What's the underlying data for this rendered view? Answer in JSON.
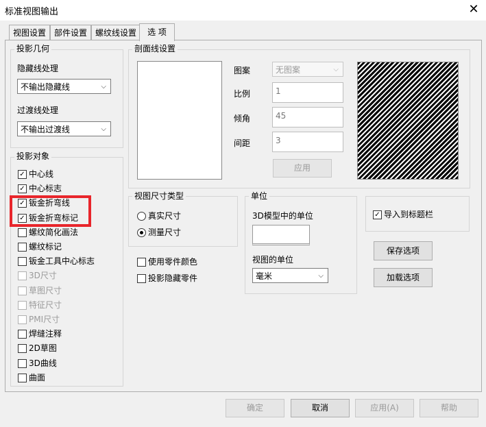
{
  "window": {
    "title": "标准视图输出"
  },
  "tabs": [
    "视图设置",
    "部件设置",
    "螺纹线设置",
    "选 项"
  ],
  "projection_geometry": {
    "title": "投影几何",
    "hidden_line_label": "隐藏线处理",
    "hidden_line_value": "不输出隐藏线",
    "transition_line_label": "过渡线处理",
    "transition_line_value": "不输出过渡线"
  },
  "projection_objects": {
    "title": "投影对象",
    "items": [
      {
        "label": "中心线",
        "checked": true,
        "enabled": true
      },
      {
        "label": "中心标志",
        "checked": true,
        "enabled": true
      },
      {
        "label": "钣金折弯线",
        "checked": true,
        "enabled": true
      },
      {
        "label": "钣金折弯标记",
        "checked": true,
        "enabled": true
      },
      {
        "label": "螺纹简化画法",
        "checked": false,
        "enabled": true
      },
      {
        "label": "螺纹标记",
        "checked": false,
        "enabled": true
      },
      {
        "label": "钣金工具中心标志",
        "checked": false,
        "enabled": true
      },
      {
        "label": "3D尺寸",
        "checked": false,
        "enabled": false
      },
      {
        "label": "草图尺寸",
        "checked": false,
        "enabled": false
      },
      {
        "label": "特征尺寸",
        "checked": false,
        "enabled": false
      },
      {
        "label": "PMI尺寸",
        "checked": false,
        "enabled": false
      },
      {
        "label": "焊缝注释",
        "checked": false,
        "enabled": true
      },
      {
        "label": "2D草图",
        "checked": false,
        "enabled": true
      },
      {
        "label": "3D曲线",
        "checked": false,
        "enabled": true
      },
      {
        "label": "曲面",
        "checked": false,
        "enabled": true
      }
    ]
  },
  "section_line": {
    "title": "剖面线设置",
    "pattern_label": "图案",
    "pattern_value": "无图案",
    "scale_label": "比例",
    "scale_value": "1",
    "angle_label": "倾角",
    "angle_value": "45",
    "spacing_label": "间距",
    "spacing_value": "3",
    "apply_label": "应用"
  },
  "dimension_type": {
    "title": "视图尺寸类型",
    "options": [
      {
        "label": "真实尺寸",
        "selected": false
      },
      {
        "label": "测量尺寸",
        "selected": true
      }
    ]
  },
  "part_options": [
    {
      "label": "使用零件颜色",
      "checked": false
    },
    {
      "label": "投影隐藏零件",
      "checked": false
    }
  ],
  "units": {
    "title": "单位",
    "model_unit_label": "3D模型中的单位",
    "model_unit_value": "",
    "view_unit_label": "视图的单位",
    "view_unit_value": "毫米"
  },
  "title_block": {
    "label": "导入到标题栏",
    "checked": true
  },
  "option_buttons": {
    "save": "保存选项",
    "load": "加载选项"
  },
  "footer": {
    "ok": "确定",
    "cancel": "取消",
    "apply": "应用(A)",
    "help": "帮助"
  },
  "colors": {
    "highlight": "#e8252b",
    "hatch": "#000000"
  }
}
